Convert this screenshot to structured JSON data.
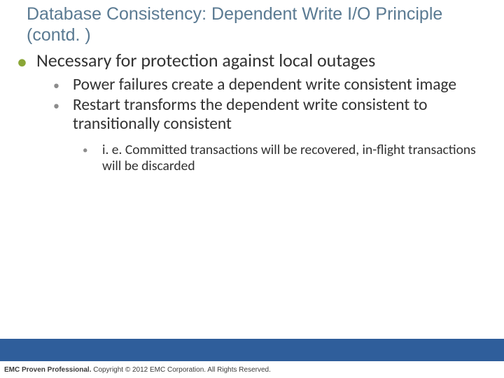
{
  "slide": {
    "title": "Database Consistency: Dependent Write I/O Principle (contd. )",
    "lvl1": "Necessary for protection against local outages",
    "lvl2": [
      "Power failures create a dependent write consistent image",
      "Restart transforms the dependent write consistent to transitionally consistent"
    ],
    "lvl3": [
      "i. e. Committed transactions will be recovered, in-flight transactions will be discarded"
    ],
    "footer": {
      "brand": "EMC Proven Professional. ",
      "rest": "Copyright © 2012 EMC Corporation. All Rights Reserved."
    }
  }
}
